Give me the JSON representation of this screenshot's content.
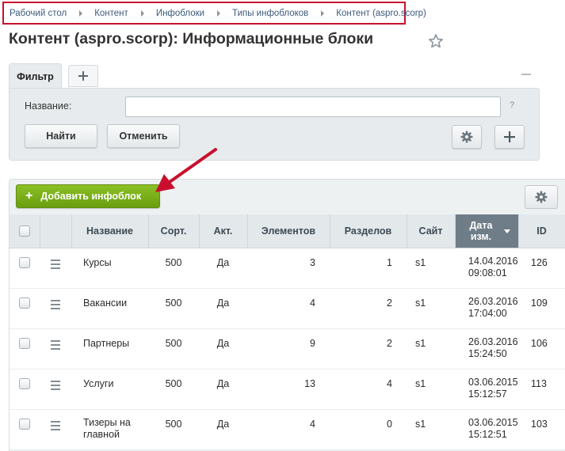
{
  "breadcrumb": [
    "Рабочий стол",
    "Контент",
    "Инфоблоки",
    "Типы инфоблоков",
    "Контент (aspro.scorp)"
  ],
  "page_title": "Контент (aspro.scorp): Информационные блоки",
  "filter": {
    "tab_label": "Фильтр",
    "add_tab_icon": "plus-icon",
    "name_label": "Название:",
    "name_value": "",
    "help": "?",
    "find_button": "Найти",
    "cancel_button": "Отменить"
  },
  "toolbar": {
    "add_button": "Добавить инфоблок"
  },
  "table": {
    "headers": {
      "name": "Название",
      "sort": "Сорт.",
      "active": "Акт.",
      "elements": "Элементов",
      "sections": "Разделов",
      "site": "Сайт",
      "date_line1": "Дата",
      "date_line2": "изм.",
      "id": "ID"
    },
    "rows": [
      {
        "name": "Курсы",
        "sort": "500",
        "active": "Да",
        "elements": "3",
        "sections": "1",
        "site": "s1",
        "date": "14.04.2016",
        "time": "09:08:01",
        "id": "126"
      },
      {
        "name": "Вакансии",
        "sort": "500",
        "active": "Да",
        "elements": "4",
        "sections": "2",
        "site": "s1",
        "date": "26.03.2016",
        "time": "17:04:00",
        "id": "109"
      },
      {
        "name": "Партнеры",
        "sort": "500",
        "active": "Да",
        "elements": "9",
        "sections": "2",
        "site": "s1",
        "date": "26.03.2016",
        "time": "15:24:50",
        "id": "106"
      },
      {
        "name": "Услуги",
        "sort": "500",
        "active": "Да",
        "elements": "13",
        "sections": "4",
        "site": "s1",
        "date": "03.06.2015",
        "time": "15:12:57",
        "id": "113"
      },
      {
        "name": "Тизеры на главной",
        "sort": "500",
        "active": "Да",
        "elements": "4",
        "sections": "0",
        "site": "s1",
        "date": "03.06.2015",
        "time": "15:12:51",
        "id": "103"
      }
    ]
  },
  "colors": {
    "accent_green": "#7cb319",
    "highlight_red": "#c8102e",
    "link": "#2f5e8c"
  }
}
